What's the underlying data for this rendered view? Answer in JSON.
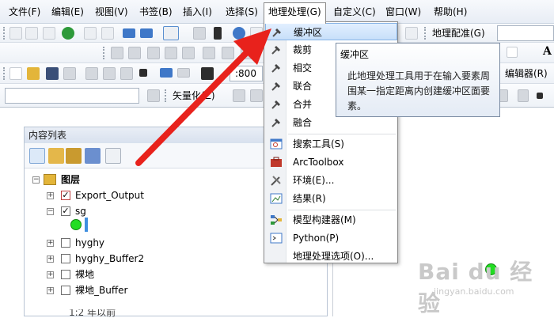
{
  "menubar": {
    "items": [
      "文件(F)",
      "编辑(E)",
      "视图(V)",
      "书签(B)",
      "插入(I)",
      "选择(S)",
      "地理处理(G)",
      "自定义(C)",
      "窗口(W)",
      "帮助(H)"
    ],
    "active_index": 6
  },
  "toolbars": {
    "georef_label": "地理配准(G)",
    "scale_value": ":800",
    "vectorize_label": "矢量化(Z)",
    "editor_label": "编辑器(R)",
    "font_size_letter": "A"
  },
  "toc": {
    "title": "内容列表",
    "root_label": "图层",
    "layers": [
      {
        "name": "Export_Output",
        "checked": true
      },
      {
        "name": "sg",
        "checked": true
      },
      {
        "name": "hyghy",
        "checked": false
      },
      {
        "name": "hyghy_Buffer2",
        "checked": false
      },
      {
        "name": "裸地",
        "checked": false
      },
      {
        "name": "裸地_Buffer",
        "checked": false
      }
    ],
    "next_group_partial": "1:2 年以前"
  },
  "dropdown": {
    "items": [
      {
        "label": "缓冲区",
        "icon": "hammer-icon",
        "highlighted": true
      },
      {
        "label": "裁剪",
        "icon": "hammer-icon"
      },
      {
        "label": "相交",
        "icon": "hammer-icon"
      },
      {
        "label": "联合",
        "icon": "hammer-icon"
      },
      {
        "label": "合并",
        "icon": "hammer-icon"
      },
      {
        "label": "融合",
        "icon": "hammer-icon"
      },
      {
        "label": "搜索工具(S)",
        "icon": "search-window-icon"
      },
      {
        "label": "ArcToolbox",
        "icon": "toolbox-icon"
      },
      {
        "label": "环境(E)...",
        "icon": "environment-icon"
      },
      {
        "label": "结果(R)",
        "icon": "results-icon"
      },
      {
        "label": "模型构建器(M)",
        "icon": "model-builder-icon"
      },
      {
        "label": "Python(P)",
        "icon": "python-window-icon"
      },
      {
        "label": "地理处理选项(O)...",
        "icon": ""
      }
    ]
  },
  "tooltip": {
    "title": "缓冲区",
    "body": "此地理处理工具用于在输入要素周围某一指定距离内创建缓冲区面要素。"
  },
  "watermark": {
    "main": "Bai du 经验",
    "sub": "jingyan.baidu.com"
  },
  "colors": {
    "accent_highlight": "#c7dff9",
    "arrow_red": "#e8221c",
    "point_green": "#22dd22",
    "link_blue": "#3f78c8"
  }
}
